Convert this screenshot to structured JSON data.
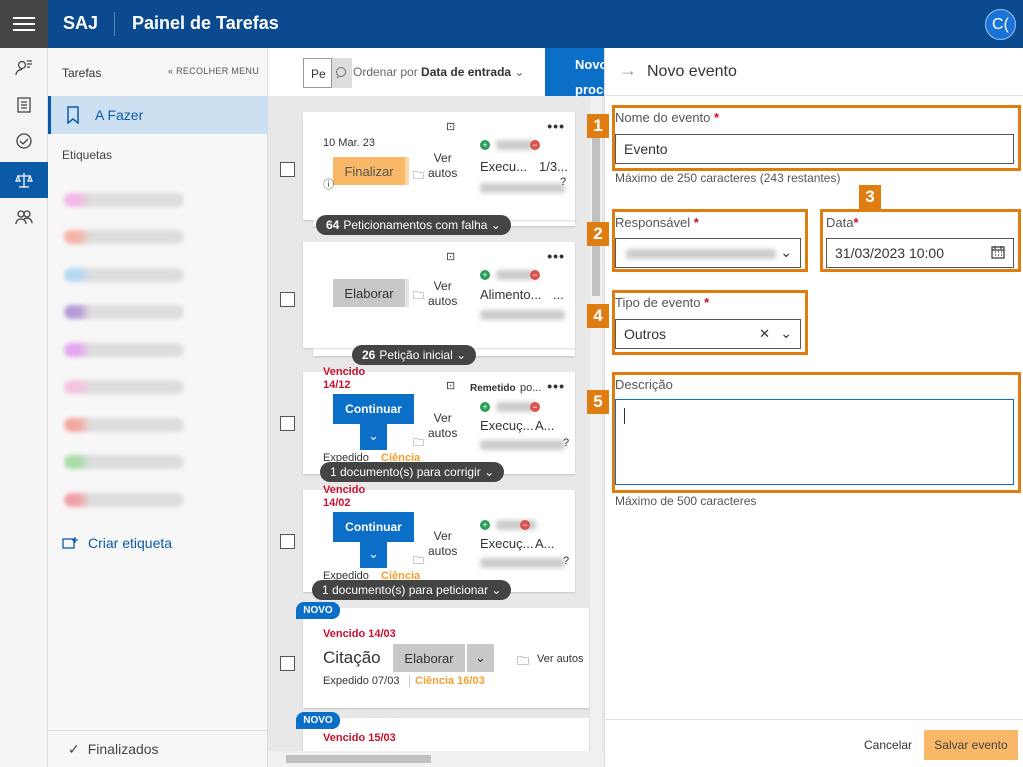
{
  "header": {
    "brand": "SAJ",
    "title": "Painel de Tarefas",
    "avatar_initials": "C("
  },
  "sidebar": {
    "section": "Tarefas",
    "collapse_label": "« RECOLHER MENU",
    "active_item": "A Fazer",
    "labels_heading": "Etiquetas",
    "create_label": "Criar etiqueta",
    "finished": "Finalizados"
  },
  "list": {
    "search_value": "Pe",
    "order_prefix": "Ordenar por ",
    "order_value": "Data de entrada",
    "novo_button": "Novo processo",
    "cards": [
      {
        "date": "10 Mar. 23",
        "action": "Finalizar",
        "ver": "Ver",
        "autos": "autos",
        "text1": "Execu...",
        "text2": "1/3...",
        "group_count": "64",
        "group_label": "Peticionamentos com falha"
      },
      {
        "action": "Elaborar",
        "ver": "Ver",
        "autos": "autos",
        "text1": "Alimento...",
        "text2": "...",
        "group_count": "26",
        "group_label": "Petição inicial"
      },
      {
        "due": "Vencido",
        "due_date": "14/12",
        "action": "Continuar",
        "remetido": "Remetido",
        "remetido_tail": "po...",
        "ver": "Ver",
        "autos": "autos",
        "text1": "Execuç...",
        "text2": "A...",
        "expedido": "Expedido",
        "ciencia": "Ciência",
        "group_label": "1 documento(s) para corrigir"
      },
      {
        "due": "Vencido",
        "due_date": "14/02",
        "action": "Continuar",
        "ver": "Ver",
        "autos": "autos",
        "text1": "Execuç...",
        "text2": "A...",
        "expedido": "Expedido",
        "ciencia": "Ciência",
        "group_label": "1 documento(s) para peticionar"
      },
      {
        "novo": "NOVO",
        "due": "Vencido 14/03",
        "title": "Citação",
        "action": "Elaborar",
        "ver_autos": "Ver autos",
        "expedido": "Expedido 07/03",
        "ciencia": "Ciência 16/03"
      },
      {
        "novo": "NOVO",
        "due": "Vencido 15/03"
      }
    ]
  },
  "panel": {
    "title": "Novo evento",
    "badges": [
      "1",
      "2",
      "3",
      "4",
      "5"
    ],
    "name_label": "Nome do evento",
    "name_value": "Evento",
    "name_hint": "Máximo de 250 caracteres (243 restantes)",
    "resp_label": "Responsável",
    "date_label": "Data",
    "date_value": "31/03/2023 10:00",
    "type_label": "Tipo de evento",
    "type_value": "Outros",
    "desc_label": "Descrição",
    "desc_hint": "Máximo de 500 caracteres",
    "required_mark": "*",
    "cancel": "Cancelar",
    "save": "Salvar evento"
  },
  "colors": {
    "brand_blue": "#0b4a8f",
    "action_blue": "#0b6fc8",
    "highlight": "#e07d10",
    "warning": "#f8b867",
    "overdue": "#c8102e"
  }
}
